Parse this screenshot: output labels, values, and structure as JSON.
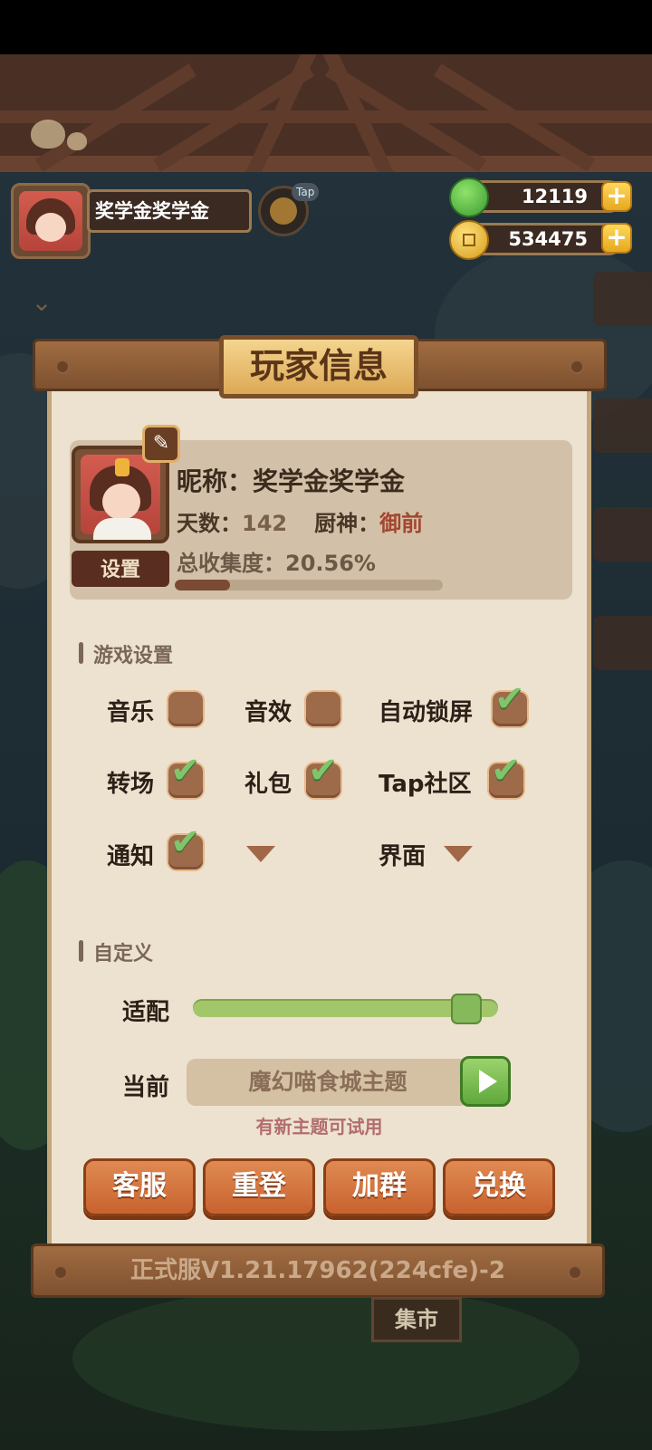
{
  "hud": {
    "player_name": "奖学金奖学金",
    "tap_badge": "Tap",
    "jade_amount": "12119",
    "coin_amount": "534475",
    "plus_symbol": "+"
  },
  "panel": {
    "title": "玩家信息",
    "profile": {
      "nickname_label": "昵称：",
      "nickname": "奖学金奖学金",
      "days_label": "天数：",
      "days": "142",
      "chef_label": "厨神：",
      "chef": "御前",
      "collection_label": "总收集度：",
      "collection": "20.56%",
      "collection_progress": 0.2056,
      "settings_button": "设置"
    },
    "game_settings": {
      "section_title": "游戏设置",
      "options": [
        {
          "label": "音乐",
          "checked": false
        },
        {
          "label": "音效",
          "checked": false
        },
        {
          "label": "自动锁屏",
          "checked": true
        },
        {
          "label": "转场",
          "checked": true
        },
        {
          "label": "礼包",
          "checked": true
        },
        {
          "label": "Tap社区",
          "checked": true
        },
        {
          "label": "通知",
          "checked": true
        }
      ],
      "dropdown_1_label": "",
      "dropdown_2_label": "界面"
    },
    "custom": {
      "section_title": "自定义",
      "adapt_label": "适配",
      "adapt_value": 0.94,
      "current_label": "当前",
      "current_theme": "魔幻喵食城主题",
      "new_theme_hint": "有新主题可试用"
    },
    "buttons": {
      "service": "客服",
      "relogin": "重登",
      "join_group": "加群",
      "redeem": "兑换"
    },
    "version": "正式服V1.21.17962(224cfe)-2"
  },
  "background": {
    "market_label": "集市"
  },
  "colors": {
    "panel_bg": "#ece2cf",
    "accent_orange": "#c8622f",
    "check_green": "#7fc56b",
    "hint_red": "#b26d6f"
  }
}
